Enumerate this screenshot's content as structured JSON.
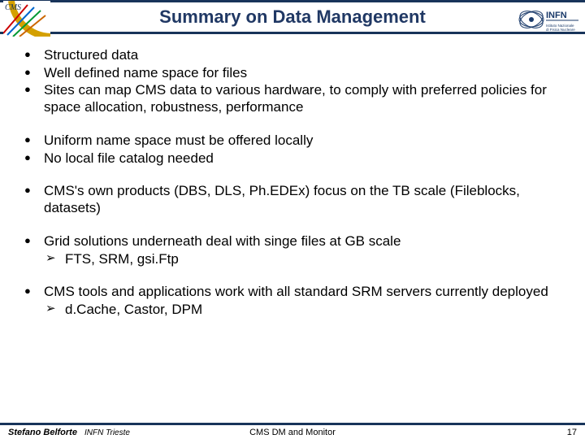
{
  "header": {
    "title": "Summary on Data Management",
    "logo_left_name": "cms-logo",
    "logo_right_name": "infn-logo"
  },
  "groups": [
    {
      "items": [
        {
          "text": "Structured data"
        },
        {
          "text": "Well defined name space for files"
        },
        {
          "text": "Sites can map CMS data to various hardware, to comply with preferred policies for space allocation, robustness, performance"
        }
      ]
    },
    {
      "items": [
        {
          "text": "Uniform name space must be offered locally"
        },
        {
          "text": "No local file catalog needed"
        }
      ]
    },
    {
      "items": [
        {
          "text": "CMS's own products (DBS, DLS, Ph.EDEx) focus on the TB scale (Fileblocks, datasets)"
        }
      ]
    },
    {
      "items": [
        {
          "text": "Grid solutions underneath deal with singe files at GB scale",
          "sub": [
            {
              "text": "FTS, SRM, gsi.Ftp"
            }
          ]
        }
      ]
    },
    {
      "items": [
        {
          "text": "CMS tools and applications work with all standard SRM servers currently deployed",
          "sub": [
            {
              "text": "d.Cache, Castor, DPM"
            }
          ]
        }
      ]
    }
  ],
  "footer": {
    "author": "Stefano Belforte",
    "affiliation": "INFN Trieste",
    "center": "CMS DM and Monitor",
    "page": "17"
  }
}
